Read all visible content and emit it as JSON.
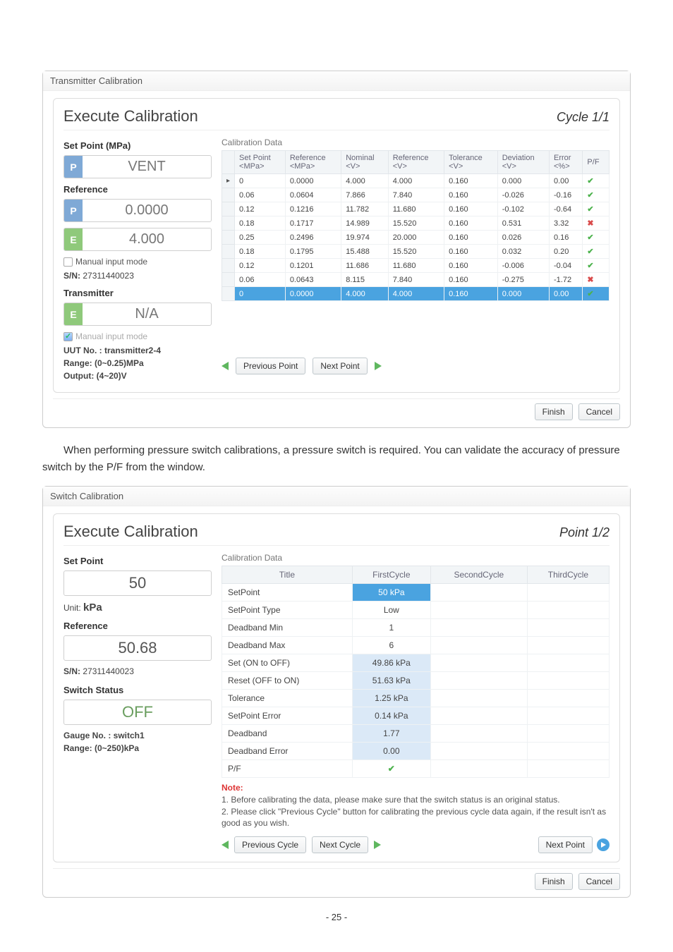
{
  "dialog1": {
    "window_title": "Transmitter Calibration",
    "exec_title": "Execute Calibration",
    "cycle": "Cycle 1/1",
    "setpoint_label": "Set Point  (MPa)",
    "calib_data_label": "Calibration Data",
    "vent": {
      "badge": "P",
      "value": "VENT"
    },
    "reference_label": "Reference",
    "ref_p": {
      "badge": "P",
      "value": "0.0000"
    },
    "ref_e": {
      "badge": "E",
      "value": "4.000"
    },
    "manual_label": "Manual input mode",
    "sn_label": "S/N:",
    "sn_value": "27311440023",
    "transmitter_label": "Transmitter",
    "tx_e": {
      "badge": "E",
      "value": "N/A"
    },
    "manual2_label": "Manual input mode",
    "uut_label": "UUT No. :  transmitter2-4",
    "range_label": "Range:   (0~0.25)MPa",
    "output_label": "Output:   (4~20)V",
    "btn_prev": "Previous Point",
    "btn_next": "Next Point",
    "btn_finish": "Finish",
    "btn_cancel": "Cancel",
    "headers": {
      "h1": "Set Point\n<MPa>",
      "h2": "Reference\n<MPa>",
      "h3": "Nominal\n<V>",
      "h4": "Reference\n<V>",
      "h5": "Tolerance\n<V>",
      "h6": "Deviation\n<V>",
      "h7": "Error\n<%>",
      "h8": "P/F"
    },
    "rows": [
      {
        "c": [
          "0",
          "0.0000",
          "4.000",
          "4.000",
          "0.160",
          "0.000",
          "0.00"
        ],
        "pf": "pass"
      },
      {
        "c": [
          "0.06",
          "0.0604",
          "7.866",
          "7.840",
          "0.160",
          "-0.026",
          "-0.16"
        ],
        "pf": "pass"
      },
      {
        "c": [
          "0.12",
          "0.1216",
          "11.782",
          "11.680",
          "0.160",
          "-0.102",
          "-0.64"
        ],
        "pf": "pass"
      },
      {
        "c": [
          "0.18",
          "0.1717",
          "14.989",
          "15.520",
          "0.160",
          "0.531",
          "3.32"
        ],
        "pf": "fail"
      },
      {
        "c": [
          "0.25",
          "0.2496",
          "19.974",
          "20.000",
          "0.160",
          "0.026",
          "0.16"
        ],
        "pf": "pass"
      },
      {
        "c": [
          "0.18",
          "0.1795",
          "15.488",
          "15.520",
          "0.160",
          "0.032",
          "0.20"
        ],
        "pf": "pass"
      },
      {
        "c": [
          "0.12",
          "0.1201",
          "11.686",
          "11.680",
          "0.160",
          "-0.006",
          "-0.04"
        ],
        "pf": "pass"
      },
      {
        "c": [
          "0.06",
          "0.0643",
          "8.115",
          "7.840",
          "0.160",
          "-0.275",
          "-1.72"
        ],
        "pf": "fail"
      },
      {
        "c": [
          "0",
          "0.0000",
          "4.000",
          "4.000",
          "0.160",
          "0.000",
          "0.00"
        ],
        "pf": "pass",
        "sel": true
      }
    ]
  },
  "para": "When performing pressure switch calibrations, a pressure switch is required. You can validate the accuracy of pressure switch by the P/F from the window.",
  "dialog2": {
    "window_title": "Switch Calibration",
    "exec_title": "Execute Calibration",
    "point": "Point 1/2",
    "setpoint_label": "Set Point",
    "calib_data_label": "Calibration Data",
    "sp_value": "50",
    "unit_label": "Unit:",
    "unit_value": "kPa",
    "reference_label": "Reference",
    "ref_value": "50.68",
    "sn_label": "S/N:",
    "sn_value": "27311440023",
    "switch_status_label": "Switch Status",
    "switch_value": "OFF",
    "gauge_label": "Gauge No. :  switch1",
    "range_label": "Range:       (0~250)kPa",
    "btn_prev": "Previous Cycle",
    "btn_next": "Next Cycle",
    "btn_nextpoint": "Next Point",
    "btn_finish": "Finish",
    "btn_cancel": "Cancel",
    "headers": {
      "h1": "Title",
      "h2": "FirstCycle",
      "h3": "SecondCycle",
      "h4": "ThirdCycle"
    },
    "rows": [
      {
        "t": "SetPoint",
        "v": "50 kPa",
        "hl": "hl"
      },
      {
        "t": "SetPoint Type",
        "v": "Low"
      },
      {
        "t": "Deadband Min",
        "v": "1"
      },
      {
        "t": "Deadband Max",
        "v": "6"
      },
      {
        "t": "Set      (ON to OFF)",
        "v": "49.86 kPa",
        "hl": "hl2"
      },
      {
        "t": "Reset  (OFF to ON)",
        "v": "51.63 kPa",
        "hl": "hl2"
      },
      {
        "t": "Tolerance",
        "v": "1.25 kPa",
        "hl": "hl2"
      },
      {
        "t": "SetPoint Error",
        "v": "0.14 kPa",
        "hl": "hl2"
      },
      {
        "t": "Deadband",
        "v": "1.77",
        "hl": "hl2"
      },
      {
        "t": "Deadband Error",
        "v": "0.00",
        "hl": "hl2"
      },
      {
        "t": "P/F",
        "v": "✔",
        "pass": true
      }
    ],
    "note_label": "Note:",
    "note_text": "1. Before calibrating the data, please make sure that the switch status is an original status.\n2. Please click \"Previous Cycle\" button for calibrating the previous cycle data again,  if the result isn't as good as you wish."
  },
  "page_number": "- 25 -"
}
